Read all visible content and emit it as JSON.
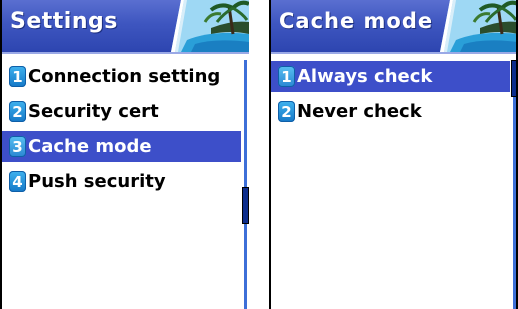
{
  "colors": {
    "title_bar": "#3e56c0",
    "selection": "#3d4fc9",
    "badge": "#1e8ad8",
    "scroll_track": "#3d6fd8",
    "scroll_thumb": "#0c2d8c"
  },
  "screens": [
    {
      "title": "Settings",
      "graphic": "beach-palm-icon",
      "selected_index": 3,
      "items": [
        {
          "number": "1",
          "label": "Connection setting"
        },
        {
          "number": "2",
          "label": "Security cert"
        },
        {
          "number": "3",
          "label": "Cache mode"
        },
        {
          "number": "4",
          "label": "Push security"
        }
      ],
      "scroll_position": 0.6
    },
    {
      "title": "Cache mode",
      "graphic": "beach-palm-icon",
      "selected_index": 1,
      "items": [
        {
          "number": "1",
          "label": "Always check"
        },
        {
          "number": "2",
          "label": "Never check"
        }
      ],
      "scroll_position": 0.0
    }
  ]
}
